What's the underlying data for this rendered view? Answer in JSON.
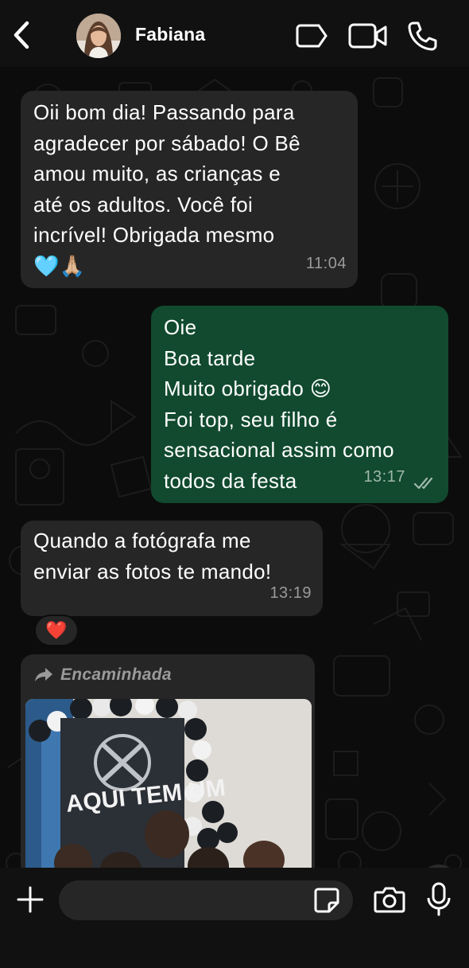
{
  "header": {
    "contact_name": "Fabiana",
    "icons": [
      "back-icon",
      "avatar",
      "label-tag-icon",
      "video-call-icon",
      "phone-icon"
    ]
  },
  "messages": [
    {
      "direction": "incoming",
      "text": "Oii bom dia! Passando para\nagradecer por sábado! O Bê\namou muito, as crianças e\naté os adultos. Você foi\nincrível! Obrigada mesmo\n🩵🙏🏼",
      "time": "11:04"
    },
    {
      "direction": "outgoing",
      "text": "Oie\nBoa tarde\nMuito obrigado 😊\nFoi top, seu filho é\nsensacional assim como\ntodos da festa",
      "time": "13:17",
      "status": "read"
    },
    {
      "direction": "incoming",
      "text": "Quando a fotógrafa me\nenviar as fotos te mando!",
      "time": "13:19",
      "reaction": "❤️"
    }
  ],
  "forwarded": {
    "label": "Encaminhada",
    "photo_banner": "AQUI TEM UM"
  },
  "composer": {
    "placeholder": ""
  },
  "colors": {
    "incoming_bubble": "#262626",
    "outgoing_bubble": "#114a2e",
    "background": "#0c0c0c",
    "header": "#111111"
  }
}
